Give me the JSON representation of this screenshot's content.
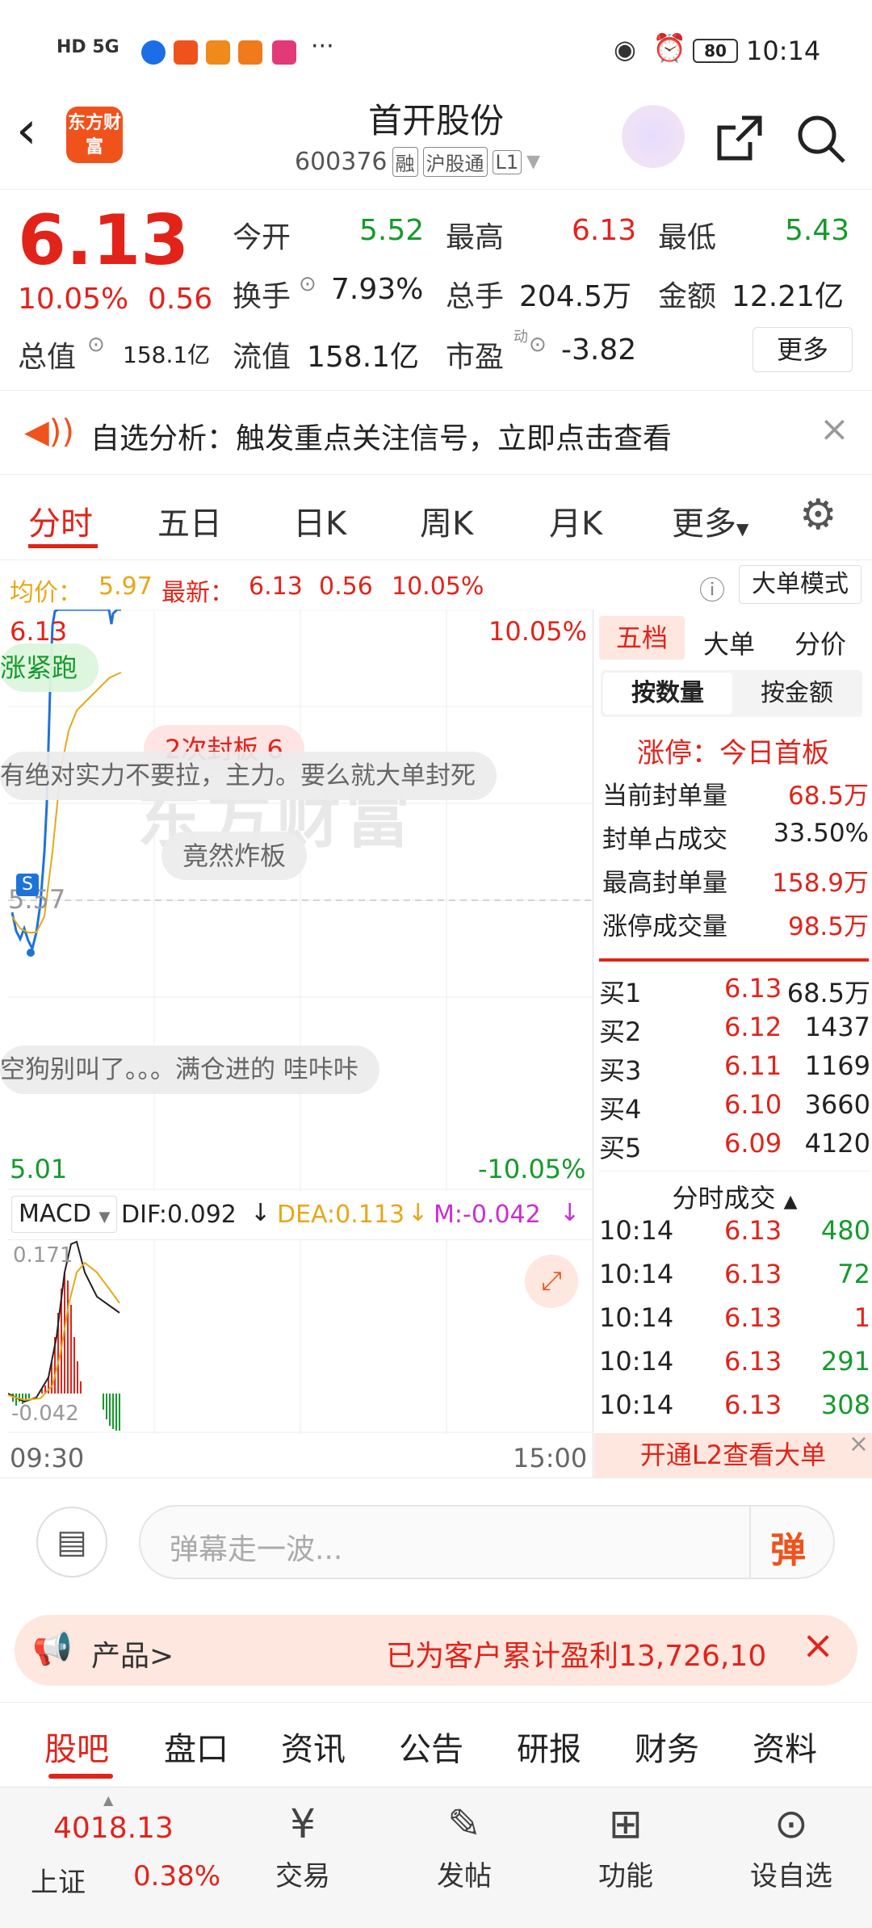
{
  "status_bar": {
    "left_icons": "HD 5G",
    "battery": "80",
    "time": "10:14"
  },
  "header": {
    "title": "首开股份",
    "code": "600376",
    "badges": [
      "融",
      "沪股通",
      "L1"
    ],
    "logo_text": "东方财富"
  },
  "quote": {
    "price": "6.13",
    "change_pct": "10.05%",
    "change": "0.56",
    "open_label": "今开",
    "open": "5.52",
    "high_label": "最高",
    "high": "6.13",
    "low_label": "最低",
    "low": "5.43",
    "turnover_label": "换手",
    "turnover": "7.93%",
    "volume_label": "总手",
    "volume": "204.5万",
    "amount_label": "金额",
    "amount": "12.21亿",
    "mktcap_label": "总值",
    "mktcap": "158.1亿",
    "float_label": "流值",
    "float": "158.1亿",
    "pe_label": "市盈",
    "pe_sup": "动",
    "pe": "-3.82",
    "more": "更多"
  },
  "notice": {
    "text": "自选分析：触发重点关注信号，立即点击查看"
  },
  "chart_tabs": [
    "分时",
    "五日",
    "日K",
    "周K",
    "月K",
    "更多"
  ],
  "chart_info": {
    "avg_label": "均价：",
    "avg": "5.97",
    "latest_label": "最新：",
    "latest": "6.13",
    "change": "0.56",
    "change_pct": "10.05%",
    "mode_button": "大单模式"
  },
  "chart": {
    "y_top": "6.13",
    "y_mid": "5.57",
    "y_bottom": "5.01",
    "pct_top": "10.05%",
    "pct_bottom": "-10.05%",
    "time_start": "09:30",
    "time_end": "15:00",
    "bubble1": "涨紧跑",
    "bubble2": "2次封板 6",
    "bubble3": "有绝对实力不要拉，主力。要么就大单封死",
    "bubble4": "竟然炸板",
    "bubble5": "空狗别叫了。。。满仓进的 哇咔咔",
    "watermark": "东方财富"
  },
  "macd": {
    "label": "MACD",
    "dif": "DIF:0.092",
    "dea": "DEA:0.113",
    "m": "M:-0.042",
    "max": "0.171",
    "min": "-0.042"
  },
  "right_panel": {
    "tabs": [
      "五档",
      "大单",
      "分价"
    ],
    "subtabs": [
      "按数量",
      "按金额"
    ],
    "limit_title": "涨停：今日首板",
    "stats": [
      {
        "label": "当前封单量",
        "value": "68.5万"
      },
      {
        "label": "封单占成交",
        "value": "33.50%"
      },
      {
        "label": "最高封单量",
        "value": "158.9万"
      },
      {
        "label": "涨停成交量",
        "value": "98.5万"
      }
    ],
    "bids": [
      {
        "label": "买1",
        "price": "6.13",
        "vol": "68.5万"
      },
      {
        "label": "买2",
        "price": "6.12",
        "vol": "1437"
      },
      {
        "label": "买3",
        "price": "6.11",
        "vol": "1169"
      },
      {
        "label": "买4",
        "price": "6.10",
        "vol": "3660"
      },
      {
        "label": "买5",
        "price": "6.09",
        "vol": "4120"
      }
    ],
    "ticks_title": "分时成交",
    "ticks": [
      {
        "time": "10:14",
        "price": "6.13",
        "vol": "480"
      },
      {
        "time": "10:14",
        "price": "6.13",
        "vol": "72"
      },
      {
        "time": "10:14",
        "price": "6.13",
        "vol": "1"
      },
      {
        "time": "10:14",
        "price": "6.13",
        "vol": "291"
      },
      {
        "time": "10:14",
        "price": "6.13",
        "vol": "308"
      }
    ],
    "l2_banner": "开通L2查看大单"
  },
  "comment": {
    "placeholder": "弹幕走一波...",
    "send": "弹"
  },
  "promo": {
    "left": "产品>",
    "right": "已为客户累计盈利13,726,10"
  },
  "bottom_tabs": [
    "股吧",
    "盘口",
    "资讯",
    "公告",
    "研报",
    "财务",
    "资料"
  ],
  "bottom_bar": {
    "index_value": "4018.13",
    "index_name": "上证",
    "index_pct": "0.38%",
    "items": [
      "交易",
      "发帖",
      "功能",
      "设自选"
    ]
  },
  "colors": {
    "up": "#e2231a",
    "down": "#159a2b",
    "accent": "#f0521c"
  }
}
